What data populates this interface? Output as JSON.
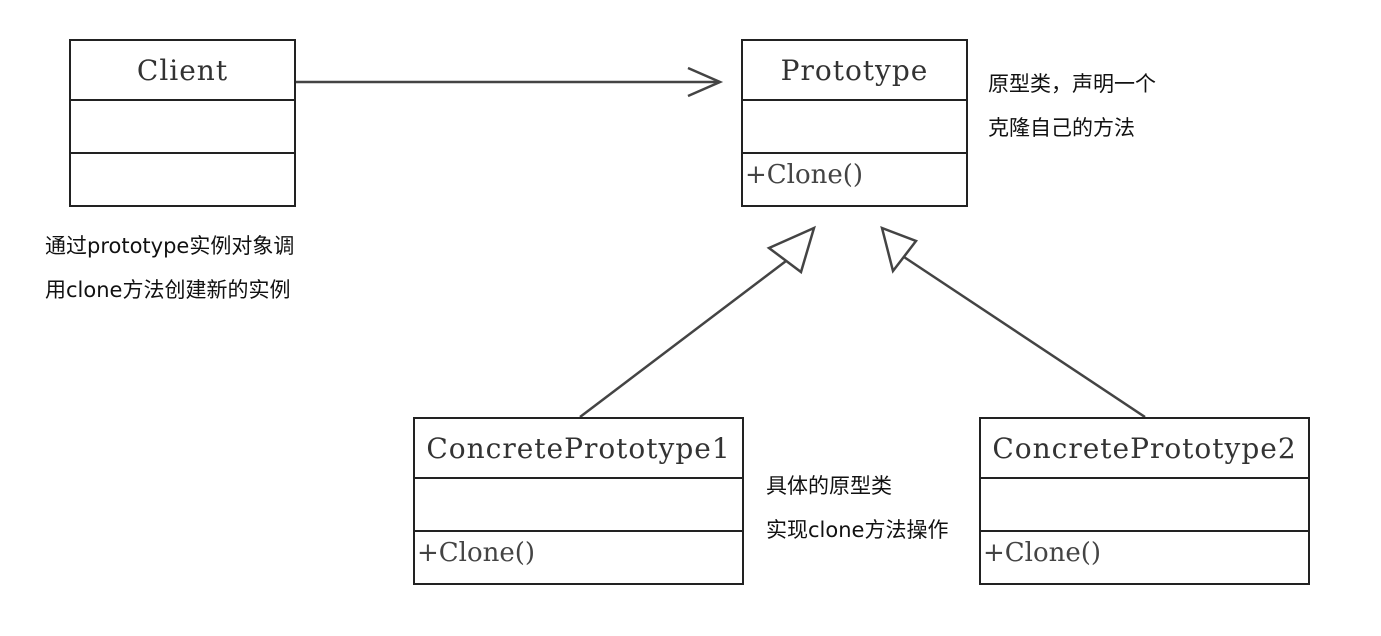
{
  "classes": {
    "client": {
      "name": "Client",
      "operation": ""
    },
    "prototype": {
      "name": "Prototype",
      "operation": "+Clone()"
    },
    "concrete1": {
      "name": "ConcretePrototype1",
      "operation": "+Clone()"
    },
    "concrete2": {
      "name": "ConcretePrototype2",
      "operation": "+Clone()"
    }
  },
  "notes": {
    "prototype": [
      "原型类，声明一个",
      "克隆自己的方法"
    ],
    "client": [
      "通过prototype实例对象调",
      "用clone方法创建新的实例"
    ],
    "concrete": [
      "具体的原型类",
      "实现clone方法操作"
    ]
  },
  "colors": {
    "line": "#444444",
    "box_border": "#222222"
  }
}
